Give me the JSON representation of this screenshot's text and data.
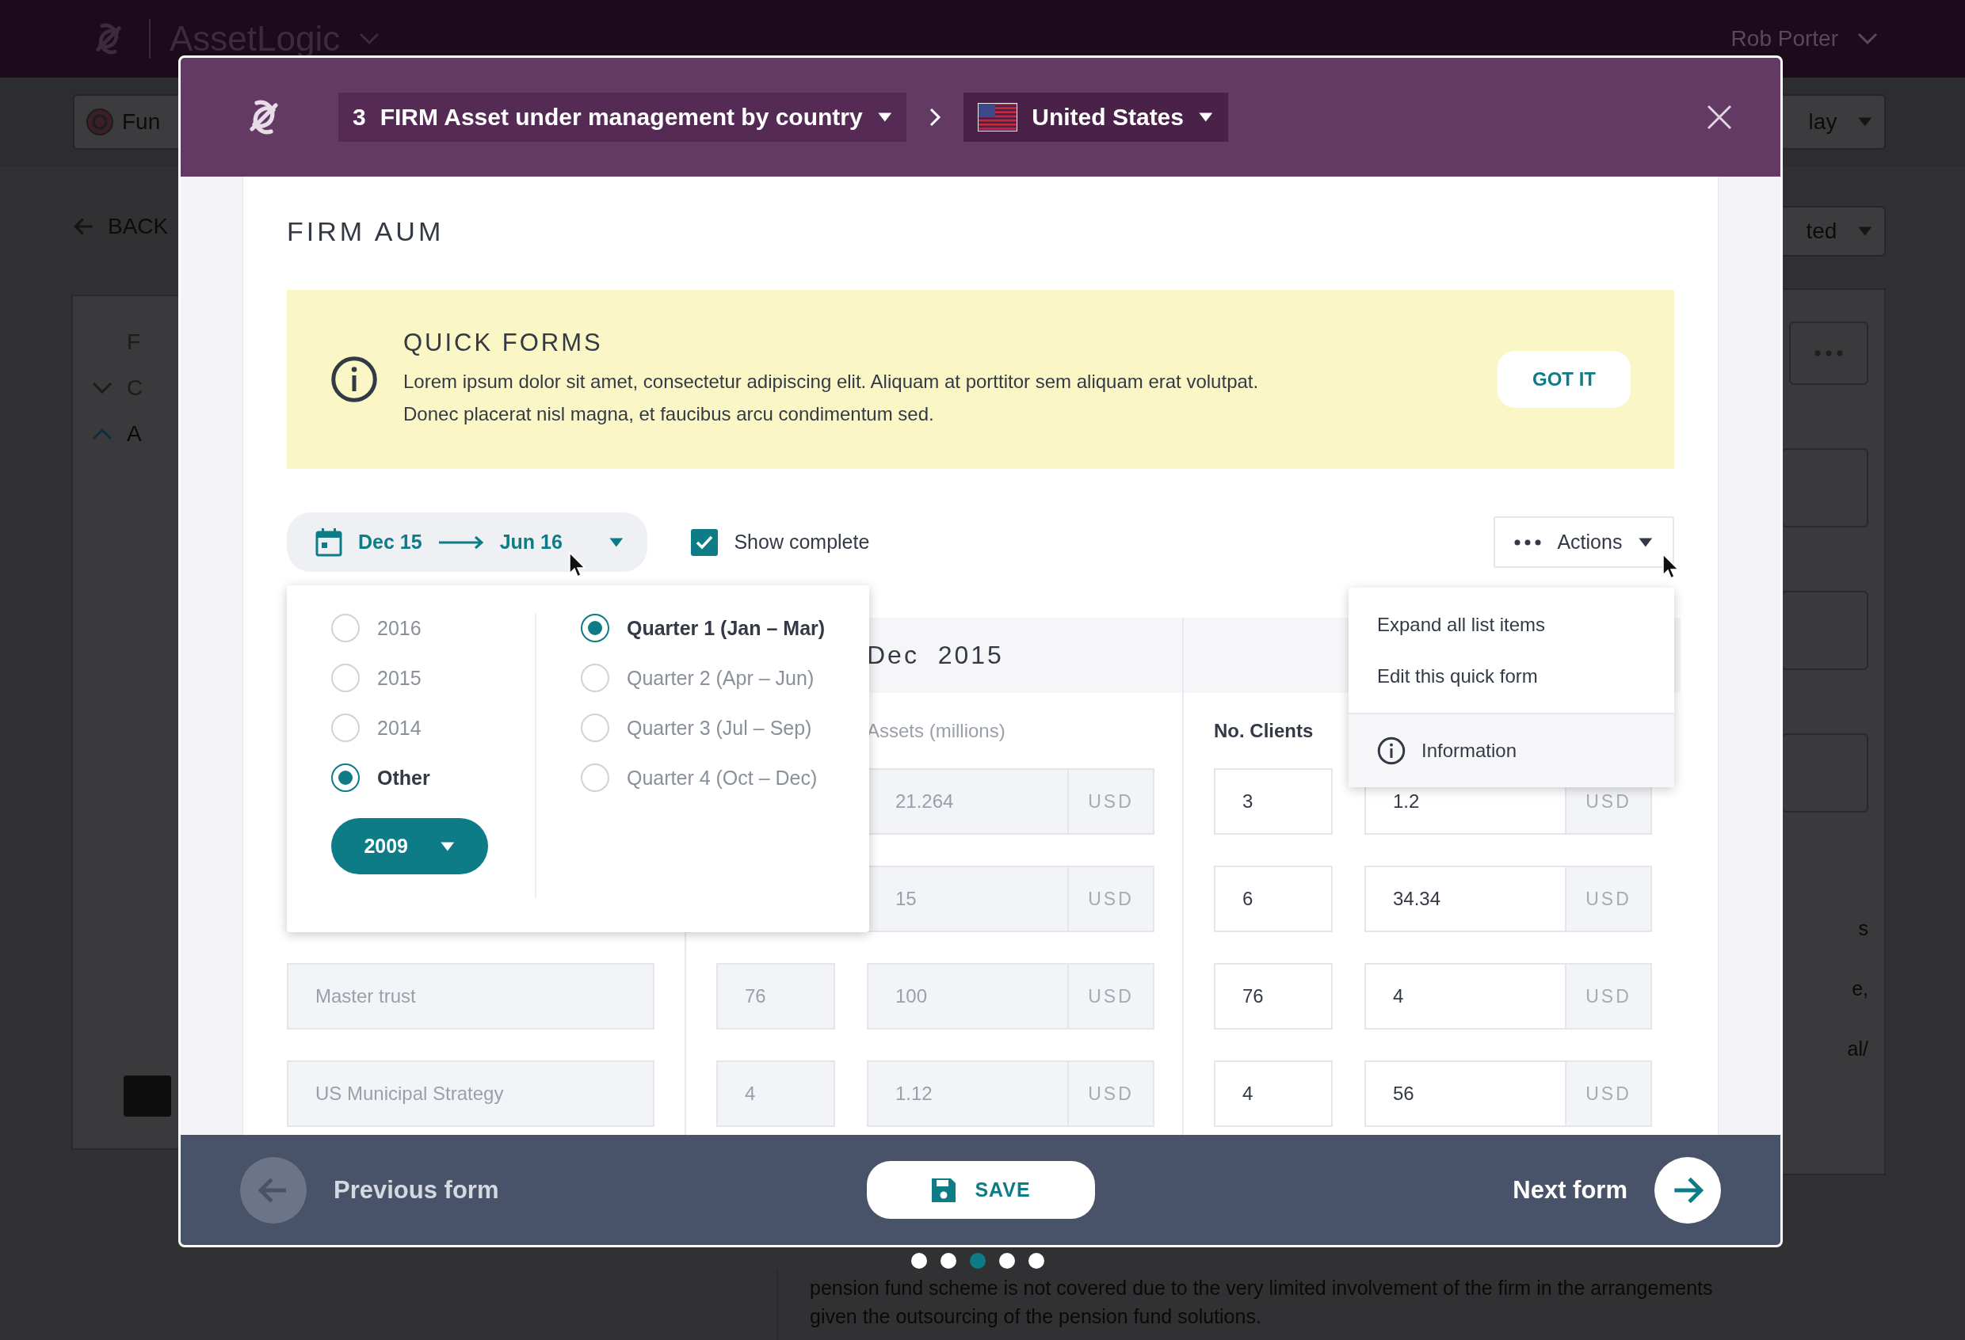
{
  "app_bar": {
    "brand": "AssetLogic",
    "user": "Rob Porter"
  },
  "sub_bar": {
    "left_pill": "Fun",
    "right_pill": "lay"
  },
  "background": {
    "back_link": "BACK",
    "status_pill": "ted",
    "left_items": [
      {
        "text": "F",
        "kind": "plain"
      },
      {
        "text": "C",
        "kind": "collapsed"
      },
      {
        "text": "A",
        "kind": "expanded"
      }
    ],
    "right_lines": [
      "s",
      "e,",
      "al/"
    ],
    "paragraph_lines": [
      "pension fund scheme is not covered due to the very limited involvement of the firm in the arrangements",
      "given the outsourcing of the pension fund solutions."
    ]
  },
  "modal": {
    "breadcrumb": [
      {
        "kind": "form",
        "number": "3",
        "label": "FIRM Asset under management by country"
      },
      {
        "kind": "country",
        "label": "United States"
      }
    ],
    "title": "FIRM AUM",
    "notice": {
      "title": "QUICK FORMS",
      "lines": [
        "Lorem ipsum dolor sit amet, consectetur adipiscing elit. Aliquam at porttitor sem aliquam erat volutpat.",
        "Donec placerat nisl magna, et faucibus arcu condimentum sed."
      ],
      "button": "GOT IT"
    },
    "date_range": {
      "from": "Dec 15",
      "to": "Jun 16"
    },
    "show_complete": {
      "label": "Show complete",
      "checked": true
    },
    "actions": {
      "label": "Actions",
      "menu": [
        {
          "kind": "plain",
          "label": "Expand all list items"
        },
        {
          "kind": "plain",
          "label": "Edit this quick form"
        },
        {
          "kind": "info",
          "label": "Information"
        }
      ]
    },
    "date_picker": {
      "years": [
        {
          "label": "2016",
          "selected": false
        },
        {
          "label": "2015",
          "selected": false
        },
        {
          "label": "2014",
          "selected": false
        },
        {
          "label": "Other",
          "selected": true
        }
      ],
      "other_year": "2009",
      "quarters": [
        {
          "label": "Quarter 1 (Jan – Mar)",
          "selected": true
        },
        {
          "label": "Quarter 2 (Apr – Jun)",
          "selected": false
        },
        {
          "label": "Quarter 3 (Jul – Sep)",
          "selected": false
        },
        {
          "label": "Quarter 4 (Oct – Dec)",
          "selected": false
        }
      ]
    },
    "table": {
      "groups": [
        {
          "header": "Dec  2015",
          "amount_label": "Assets (millions)",
          "disabled": true
        },
        {
          "count_label": "No. Clients",
          "disabled": false
        }
      ],
      "rows": [
        {
          "cells": [
            {
              "amount": "21.264",
              "unit": "USD"
            },
            {
              "count": "3",
              "amount": "1.2",
              "unit": "USD"
            }
          ]
        },
        {
          "cells": [
            {
              "amount": "15",
              "unit": "USD"
            },
            {
              "count": "6",
              "amount": "34.34",
              "unit": "USD"
            }
          ]
        },
        {
          "name": "Master trust",
          "cells": [
            {
              "count": "76",
              "amount": "100",
              "unit": "USD"
            },
            {
              "count": "76",
              "amount": "4",
              "unit": "USD"
            }
          ]
        },
        {
          "name": "US Municipal Strategy",
          "cells": [
            {
              "count": "4",
              "amount": "1.12",
              "unit": "USD"
            },
            {
              "count": "4",
              "amount": "56",
              "unit": "USD"
            }
          ]
        }
      ]
    },
    "footer": {
      "previous": "Previous form",
      "save": "SAVE",
      "next": "Next form"
    },
    "pages": [
      {
        "selected": false
      },
      {
        "selected": false
      },
      {
        "selected": true
      },
      {
        "selected": false
      },
      {
        "selected": false
      }
    ]
  }
}
